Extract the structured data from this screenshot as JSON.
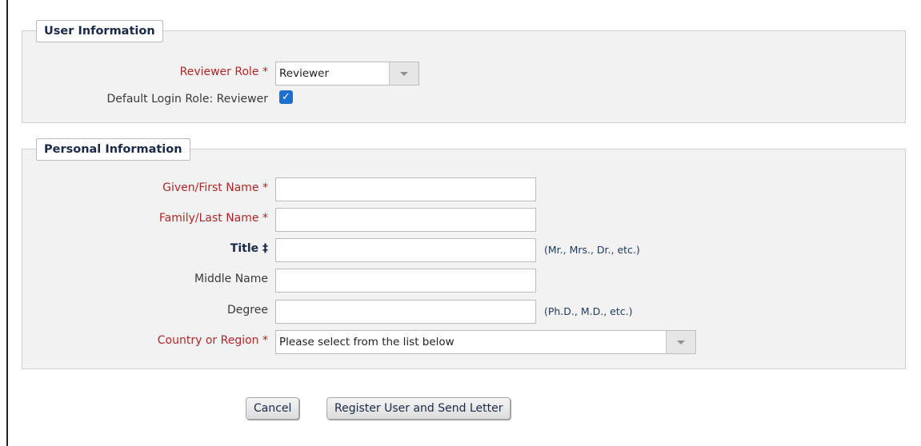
{
  "user_info": {
    "legend": "User Information",
    "reviewer_role_label": "Reviewer Role *",
    "reviewer_role_value": "Reviewer",
    "default_login_label": "Default Login Role: Reviewer",
    "default_login_checked": true
  },
  "personal_info": {
    "legend": "Personal Information",
    "fields": {
      "given_name": {
        "label": "Given/First Name *",
        "value": ""
      },
      "family_name": {
        "label": "Family/Last Name *",
        "value": ""
      },
      "title": {
        "label": "Title ‡",
        "value": "",
        "hint": "(Mr., Mrs., Dr., etc.)"
      },
      "middle_name": {
        "label": "Middle Name",
        "value": ""
      },
      "degree": {
        "label": "Degree",
        "value": "",
        "hint": "(Ph.D., M.D., etc.)"
      },
      "country": {
        "label": "Country or Region *",
        "value": "Please select from the list below"
      }
    }
  },
  "actions": {
    "cancel_label": "Cancel",
    "register_label": "Register User and Send Letter"
  },
  "icons": {
    "checkbox": "check-icon",
    "dropdown": "chevron-down-icon"
  },
  "colors": {
    "required_label": "#b32626",
    "checkbox": "#1f6fd0",
    "fieldset_bg": "#f2f2f2"
  }
}
